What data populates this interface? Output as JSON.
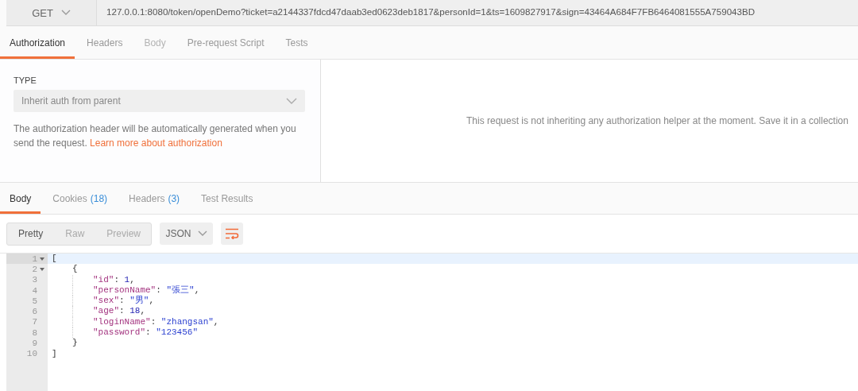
{
  "request": {
    "method": "GET",
    "url": "127.0.0.1:8080/token/openDemo?ticket=a2144337fdcd47daab3ed0623deb1817&personId=1&ts=1609827917&sign=43464A684F7FB6464081555A759043BD"
  },
  "request_tabs": [
    {
      "label": "Authorization",
      "selected": true,
      "disabled": false
    },
    {
      "label": "Headers",
      "selected": false,
      "disabled": false
    },
    {
      "label": "Body",
      "selected": false,
      "disabled": true
    },
    {
      "label": "Pre-request Script",
      "selected": false,
      "disabled": false
    },
    {
      "label": "Tests",
      "selected": false,
      "disabled": false
    }
  ],
  "auth": {
    "type_label": "TYPE",
    "type_value": "Inherit auth from parent",
    "description": "The authorization header will be automatically generated when you send the request.",
    "link": "Learn more about authorization",
    "helper_message": "This request is not inheriting any authorization helper at the moment. Save it in a collection"
  },
  "response_tabs": [
    {
      "label": "Body",
      "selected": true
    },
    {
      "label": "Cookies",
      "count": "(18)",
      "selected": false
    },
    {
      "label": "Headers",
      "count": "(3)",
      "selected": false
    },
    {
      "label": "Test Results",
      "selected": false
    }
  ],
  "view_modes": [
    {
      "label": "Pretty",
      "selected": true
    },
    {
      "label": "Raw",
      "selected": false
    },
    {
      "label": "Preview",
      "selected": false
    }
  ],
  "format": "JSON",
  "code": [
    {
      "number": "1",
      "tokens": [
        {
          "kind": "punct",
          "text": "["
        }
      ],
      "children": [
        {
          "number": "2",
          "tokens": [
            {
              "kind": "punct",
              "text": "{"
            }
          ],
          "children": [
            {
              "number": "3",
              "tokens": [
                {
                  "kind": "key",
                  "text": "\"id\""
                },
                {
                  "kind": "punct",
                  "text": ": "
                },
                {
                  "kind": "number",
                  "text": "1"
                },
                {
                  "kind": "punct",
                  "text": ","
                }
              ]
            },
            {
              "number": "4",
              "tokens": [
                {
                  "kind": "key",
                  "text": "\"personName\""
                },
                {
                  "kind": "punct",
                  "text": ": "
                },
                {
                  "kind": "string",
                  "text": "\"張三\""
                },
                {
                  "kind": "punct",
                  "text": ","
                }
              ]
            },
            {
              "number": "5",
              "tokens": [
                {
                  "kind": "key",
                  "text": "\"sex\""
                },
                {
                  "kind": "punct",
                  "text": ": "
                },
                {
                  "kind": "string",
                  "text": "\"男\""
                },
                {
                  "kind": "punct",
                  "text": ","
                }
              ]
            },
            {
              "number": "6",
              "tokens": [
                {
                  "kind": "key",
                  "text": "\"age\""
                },
                {
                  "kind": "punct",
                  "text": ": "
                },
                {
                  "kind": "number",
                  "text": "18"
                },
                {
                  "kind": "punct",
                  "text": ","
                }
              ]
            },
            {
              "number": "7",
              "tokens": [
                {
                  "kind": "key",
                  "text": "\"loginName\""
                },
                {
                  "kind": "punct",
                  "text": ": "
                },
                {
                  "kind": "string",
                  "text": "\"zhangsan\""
                },
                {
                  "kind": "punct",
                  "text": ","
                }
              ]
            },
            {
              "number": "8",
              "tokens": [
                {
                  "kind": "key",
                  "text": "\"password\""
                },
                {
                  "kind": "punct",
                  "text": ": "
                },
                {
                  "kind": "string",
                  "text": "\"123456\""
                }
              ]
            }
          ]
        },
        {
          "number": "9",
          "tokens": [
            {
              "kind": "punct",
              "text": "}"
            }
          ]
        }
      ]
    },
    {
      "number": "10",
      "tokens": [
        {
          "kind": "punct",
          "text": "]"
        }
      ]
    }
  ]
}
